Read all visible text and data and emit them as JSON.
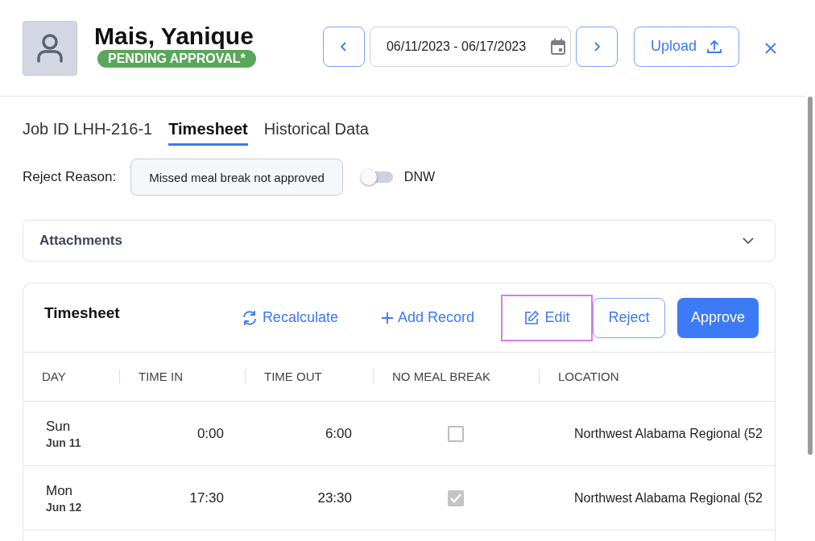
{
  "header": {
    "name": "Mais, Yanique",
    "status": "PENDING APPROVAL*",
    "date_range": "06/11/2023 - 06/17/2023",
    "upload_label": "Upload"
  },
  "tabs": [
    {
      "label": "Job ID LHH-216-1",
      "selected": false
    },
    {
      "label": "Timesheet",
      "selected": true
    },
    {
      "label": "Historical Data",
      "selected": false
    }
  ],
  "reject": {
    "label": "Reject Reason:",
    "value": "Missed meal break not approved",
    "dnw": {
      "label": "DNW",
      "on": false
    }
  },
  "attachments": {
    "title": "Attachments",
    "expanded": false
  },
  "timesheet": {
    "title": "Timesheet",
    "actions": [
      {
        "kind": "recalculate",
        "label": "Recalculate",
        "focused": false
      },
      {
        "kind": "add",
        "label": "Add Record",
        "focused": false
      },
      {
        "kind": "edit",
        "label": "Edit",
        "focused": true
      },
      {
        "kind": "reject",
        "label": "Reject",
        "focused": false
      },
      {
        "kind": "approve",
        "label": "Approve",
        "focused": false
      }
    ],
    "columns": [
      "DAY",
      "TIME IN",
      "TIME OUT",
      "NO MEAL BREAK",
      "LOCATION"
    ],
    "rows": [
      {
        "day": "Sun",
        "date": "Jun 11",
        "time_in": "0:00",
        "time_out": "6:00",
        "no_meal_break": false,
        "location": "Northwest Alabama Regional (52"
      },
      {
        "day": "Mon",
        "date": "Jun 12",
        "time_in": "17:30",
        "time_out": "23:30",
        "no_meal_break": true,
        "location": "Northwest Alabama Regional (52"
      }
    ]
  }
}
